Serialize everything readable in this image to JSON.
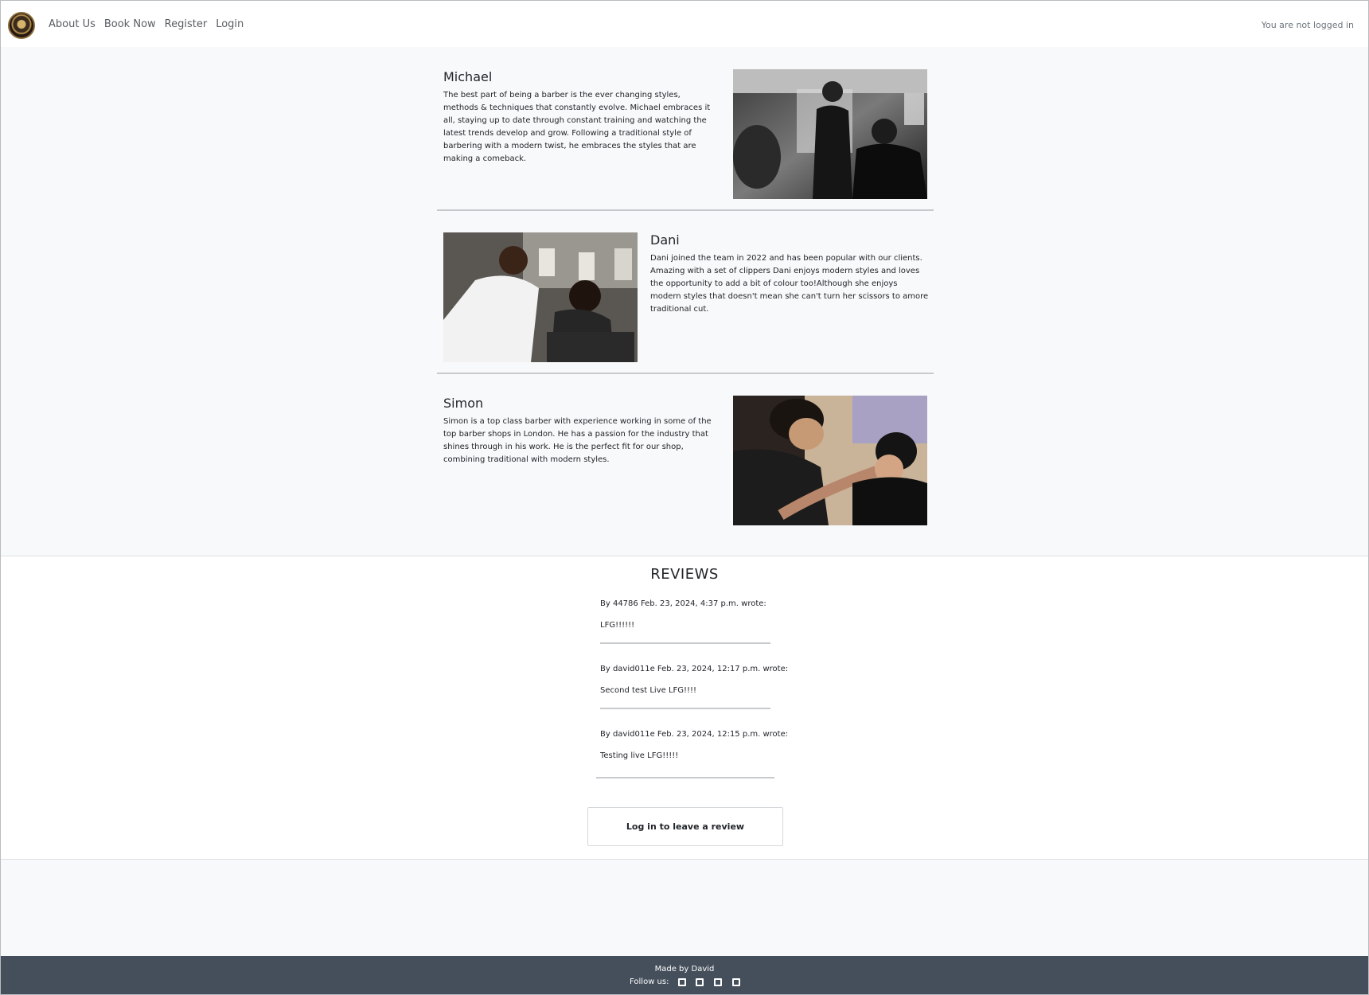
{
  "nav": {
    "logo_alt": "Barbershop logo",
    "links": [
      "About Us",
      "Book Now",
      "Register",
      "Login"
    ],
    "status": "You are not logged in"
  },
  "barbers": [
    {
      "name": "Michael",
      "bio": "The best part of being a barber is the ever changing styles, methods & techniques that constantly evolve. Michael embraces it all, staying up to date through constant training and watching the latest trends develop and grow. Following a traditional style of barbering with a modern twist, he embraces the styles that are making a comeback."
    },
    {
      "name": "Dani",
      "bio": "Dani joined the team in 2022 and has been popular with our clients. Amazing with a set of clippers Dani enjoys modern styles and loves the opportunity to add a bit of colour too!Although she enjoys modern styles that doesn't mean she can't turn her scissors to amore traditional cut."
    },
    {
      "name": "Simon",
      "bio": "Simon is a top class barber with experience working in some of the top barber shops in London. He has a passion for the industry that shines through in his work. He is the perfect fit for our shop, combining traditional with modern styles."
    }
  ],
  "reviews": {
    "title": "REVIEWS",
    "items": [
      {
        "meta": "By 44786 Feb. 23, 2024, 4:37 p.m. wrote:",
        "body": "LFG!!!!!!"
      },
      {
        "meta": "By david011e Feb. 23, 2024, 12:17 p.m. wrote:",
        "body": "Second test Live LFG!!!!"
      },
      {
        "meta": "By david011e Feb. 23, 2024, 12:15 p.m. wrote:",
        "body": "Testing live LFG!!!!!"
      }
    ],
    "login_button": "Log in to leave a review"
  },
  "footer": {
    "made_by": "Made by David",
    "follow": "Follow us:",
    "social_icons": [
      "facebook-icon",
      "twitter-icon",
      "instagram-icon",
      "youtube-icon"
    ]
  }
}
